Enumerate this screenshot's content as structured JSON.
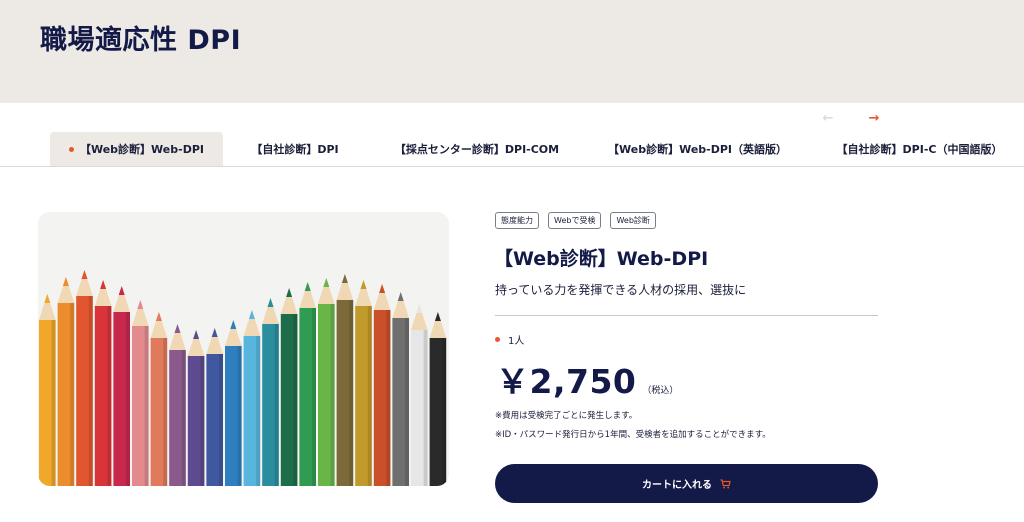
{
  "header": {
    "title": "職場適応性 DPI"
  },
  "carousel": {
    "prev_icon": "arrow-left-icon",
    "next_icon": "arrow-right-icon",
    "prev_glyph": "←",
    "next_glyph": "→"
  },
  "tabs": [
    {
      "label": "【Web診断】Web-DPI",
      "active": true
    },
    {
      "label": "【自社診断】DPI",
      "active": false
    },
    {
      "label": "【採点センター診断】DPI-COM",
      "active": false
    },
    {
      "label": "【Web診断】Web-DPI（英語版）",
      "active": false
    },
    {
      "label": "【自社診断】DPI-C（中国語版）",
      "active": false
    }
  ],
  "product": {
    "image_icon": "colored-pencils-image",
    "tags": [
      "態度能力",
      "Webで受検",
      "Web診断"
    ],
    "title": "【Web診断】Web-DPI",
    "subtitle": "持っている力を発揮できる人材の採用、選抜に",
    "unit": "1人",
    "price": "￥2,750",
    "tax_note": "（税込）",
    "notes": [
      "※費用は受検完了ごとに発生します。",
      "※ID・パスワード発行日から1年間、受検者を追加することができます。"
    ],
    "cart_button": "カートに入れる",
    "cart_icon": "cart-icon"
  },
  "colors": {
    "navy": "#131a48",
    "accent": "#e8582c",
    "banner_bg": "#edeae5"
  }
}
